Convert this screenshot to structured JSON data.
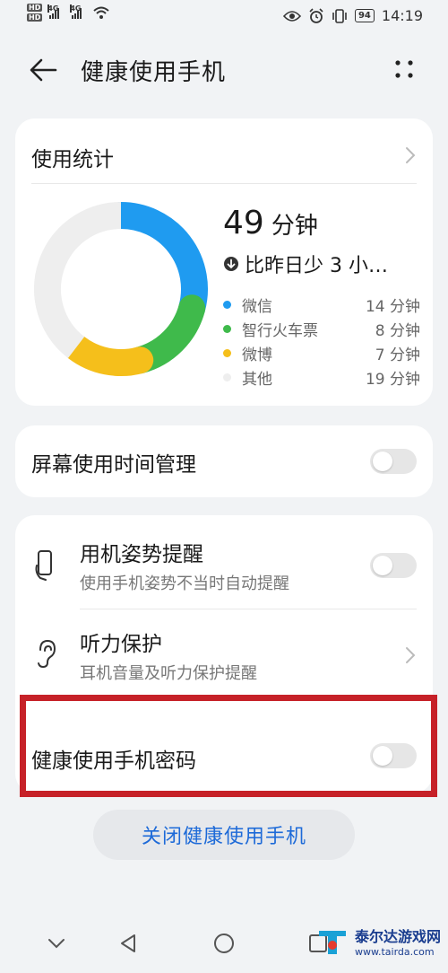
{
  "status_bar": {
    "hd1": "HD",
    "hd2": "HD",
    "net1": "4G",
    "net2": "4G",
    "battery": "94",
    "time": "14:19"
  },
  "header": {
    "title": "健康使用手机"
  },
  "stats_card": {
    "title": "使用统计",
    "total_value": "49",
    "total_unit": "分钟",
    "compare_text": "比昨日少 3 小…",
    "apps": [
      {
        "name": "微信",
        "value": "14 分钟",
        "minutes": 14,
        "color": "#1f9bf0"
      },
      {
        "name": "智行火车票",
        "value": "8 分钟",
        "minutes": 8,
        "color": "#3fba4b"
      },
      {
        "name": "微博",
        "value": "7 分钟",
        "minutes": 7,
        "color": "#f5bf1b"
      },
      {
        "name": "其他",
        "value": "19 分钟",
        "minutes": 19,
        "color": "#eeeeee"
      }
    ]
  },
  "screen_time": {
    "label": "屏幕使用时间管理",
    "enabled": false
  },
  "posture": {
    "label": "用机姿势提醒",
    "sub": "使用手机姿势不当时自动提醒",
    "enabled": false
  },
  "hearing": {
    "label": "听力保护",
    "sub": "耳机音量及听力保护提醒"
  },
  "password": {
    "label": "健康使用手机密码",
    "enabled": false
  },
  "close_button": "关闭健康使用手机",
  "watermark": {
    "name": "泰尔达游戏网",
    "url": "www.tairda.com"
  }
}
